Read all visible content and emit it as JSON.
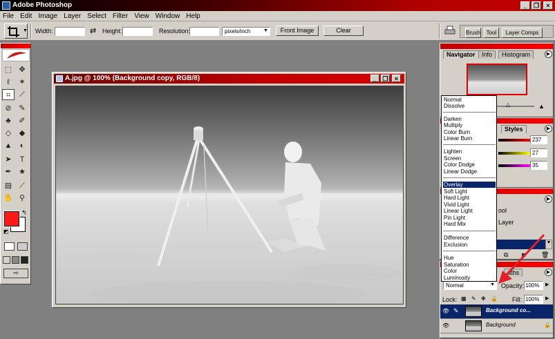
{
  "app": {
    "title": "Adobe Photoshop"
  },
  "menu": [
    "File",
    "Edit",
    "Image",
    "Layer",
    "Select",
    "Filter",
    "View",
    "Window",
    "Help"
  ],
  "options": {
    "width_label": "Width:",
    "height_label": "Height:",
    "resolution_label": "Resolution:",
    "resolution_unit": "pixels/inch",
    "front_image": "Front Image",
    "clear": "Clear"
  },
  "palette_well": {
    "tabs": [
      "Brush",
      "Tool",
      "Layer Comps"
    ]
  },
  "document": {
    "title": "A.jpg @ 100% (Background copy, RGB/8)"
  },
  "navigator": {
    "tabs": [
      "Navigator",
      "Info",
      "Histogram"
    ]
  },
  "color_panel": {
    "tab": "Styles",
    "values": [
      "237",
      "27",
      "35"
    ],
    "slider_colors": [
      "#ff0000",
      "#ffff00",
      "#ff00ff"
    ]
  },
  "history_panel": {
    "items": [
      "ool",
      "Layer"
    ]
  },
  "blend_modes": {
    "groups": [
      [
        "Normal",
        "Dissolve"
      ],
      [
        "Darken",
        "Multiply",
        "Color Burn",
        "Linear Burn"
      ],
      [
        "Lighten",
        "Screen",
        "Color Dodge",
        "Linear Dodge"
      ],
      [
        "Overlay",
        "Soft Light",
        "Hard Light",
        "Vivid Light",
        "Linear Light",
        "Pin Light",
        "Hard Mix"
      ],
      [
        "Difference",
        "Exclusion"
      ],
      [
        "Hue",
        "Saturation",
        "Color",
        "Luminosity"
      ]
    ],
    "selected": "Overlay",
    "current": "Normal"
  },
  "layers": {
    "paths_tab": "aths",
    "opacity_label": "Opacity:",
    "opacity_value": "100%",
    "fill_label": "Fill:",
    "fill_value": "100%",
    "lock_label": "Lock:",
    "items": [
      {
        "name": "Background co...",
        "selected": true
      },
      {
        "name": "Background",
        "selected": false
      }
    ]
  },
  "colors": {
    "foreground": "#ff1a1a",
    "background": "#ffffff",
    "accent": "#c00000",
    "selection": "#0a246a",
    "arrow": "#e0202a"
  }
}
